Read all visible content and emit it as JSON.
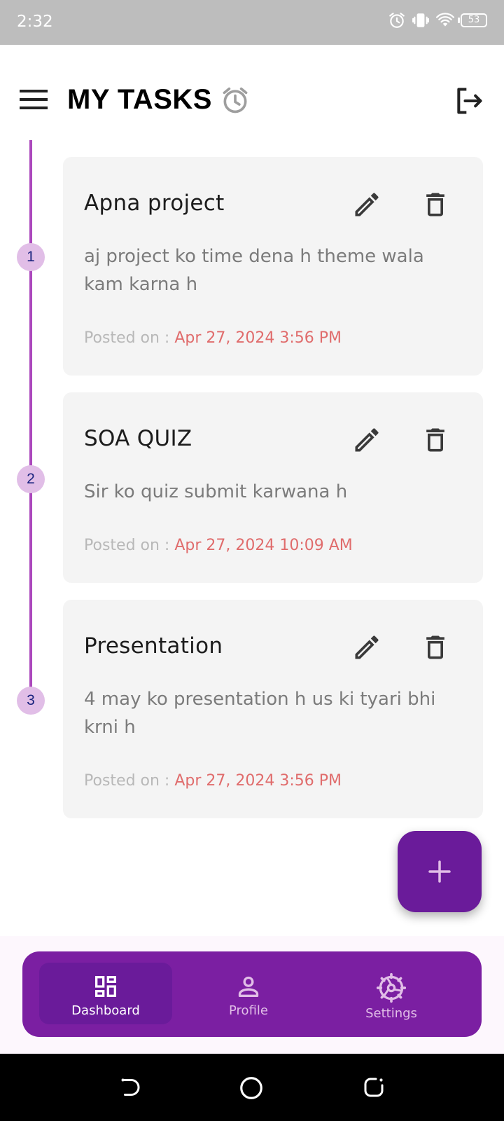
{
  "status_bar": {
    "time": "2:32",
    "battery": "53"
  },
  "header": {
    "title": "MY TASKS",
    "icons": [
      "menu-icon",
      "alarm-icon",
      "logout-icon"
    ]
  },
  "tasks": [
    {
      "index": "1",
      "title": "Apna project",
      "description": "aj project ko time dena h theme wala kam karna h",
      "posted_label": "Posted on : ",
      "posted_date": "Apr 27, 2024 3:56 PM"
    },
    {
      "index": "2",
      "title": "SOA QUIZ",
      "description": "Sir ko quiz submit karwana h",
      "posted_label": "Posted on : ",
      "posted_date": "Apr 27, 2024 10:09 AM"
    },
    {
      "index": "3",
      "title": "Presentation",
      "description": "4 may ko presentation h us ki tyari bhi krni h",
      "posted_label": "Posted on : ",
      "posted_date": "Apr 27, 2024 3:56 PM"
    }
  ],
  "fab": {
    "icon": "plus-icon"
  },
  "bottom_nav": {
    "items": [
      {
        "label": "Dashboard",
        "icon": "dashboard-icon",
        "active": true
      },
      {
        "label": "Profile",
        "icon": "person-icon",
        "active": false
      },
      {
        "label": "Settings",
        "icon": "settings-icon",
        "active": false
      }
    ]
  },
  "colors": {
    "primary": "#7b1fa2",
    "primary_dark": "#6a1b9a",
    "timeline": "#ab47bc",
    "timeline_dot": "#e1bee7",
    "date_text": "#e06c6c",
    "card_bg": "#f4f4f4"
  }
}
